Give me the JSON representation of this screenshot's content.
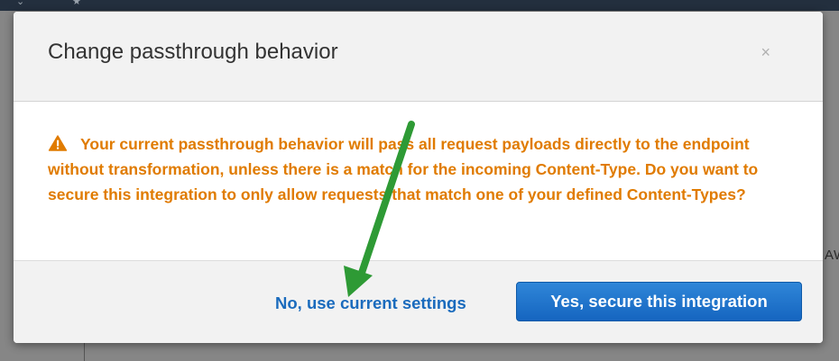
{
  "background": {
    "partial_text": "AW"
  },
  "modal": {
    "title": "Change passthrough behavior",
    "close_label": "×",
    "warning_text": "Your current passthrough behavior will pass all request payloads directly to the endpoint without transformation, unless there is a match for the incoming Content-Type. Do you want to secure this integration to only allow requests that match one of your defined Content-Types?",
    "secondary_button": "No, use current settings",
    "primary_button": "Yes, secure this integration"
  },
  "icons": {
    "warning": "warning-triangle-icon",
    "annotation": "green-arrow-annotation"
  },
  "colors": {
    "warning_text": "#e07b00",
    "primary_button": "#1e72c6",
    "link": "#1a6bbd",
    "annotation_arrow": "#2e9a35"
  }
}
